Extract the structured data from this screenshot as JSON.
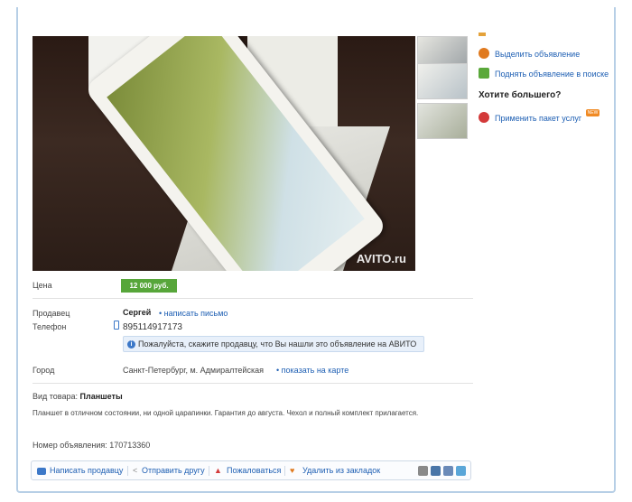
{
  "photo": {
    "watermark": "AVITO.ru"
  },
  "sidebar": {
    "highlight": "Выделить объявление",
    "raise": "Поднять объявление в поиске",
    "more_title": "Хотите большего?",
    "package": "Применить пакет услуг",
    "new_badge": "NEW"
  },
  "details": {
    "price_label": "Цена",
    "price": "12 000 руб.",
    "seller_label": "Продавец",
    "seller": "Сергей",
    "write_letter": "• написать письмо",
    "phone_label": "Телефон",
    "phone": "895114917173",
    "notice": "Пожалуйста, скажите продавцу, что Вы нашли это объявление на АВИТО",
    "city_label": "Город",
    "city": "Санкт-Петербург, м. Адмиралтейская",
    "show_map": "• показать на карте",
    "goods_label": "Вид товара:",
    "goods_value": "Планшеты",
    "description": "Планшет в отличном состоянии, ни одной царапинки. Гарантия до августа. Чехол и полный комплект прилагается.",
    "ad_number": "Номер объявления: 170713360"
  },
  "actions": {
    "write_seller": "Написать продавцу",
    "send_friend": "Отправить другу",
    "complain": "Пожаловаться",
    "remove_bookmark": "Удалить из закладок"
  },
  "colors": {
    "link": "#1e5fb3",
    "price_bg": "#57a63a",
    "frame": "#b7cfe6"
  }
}
